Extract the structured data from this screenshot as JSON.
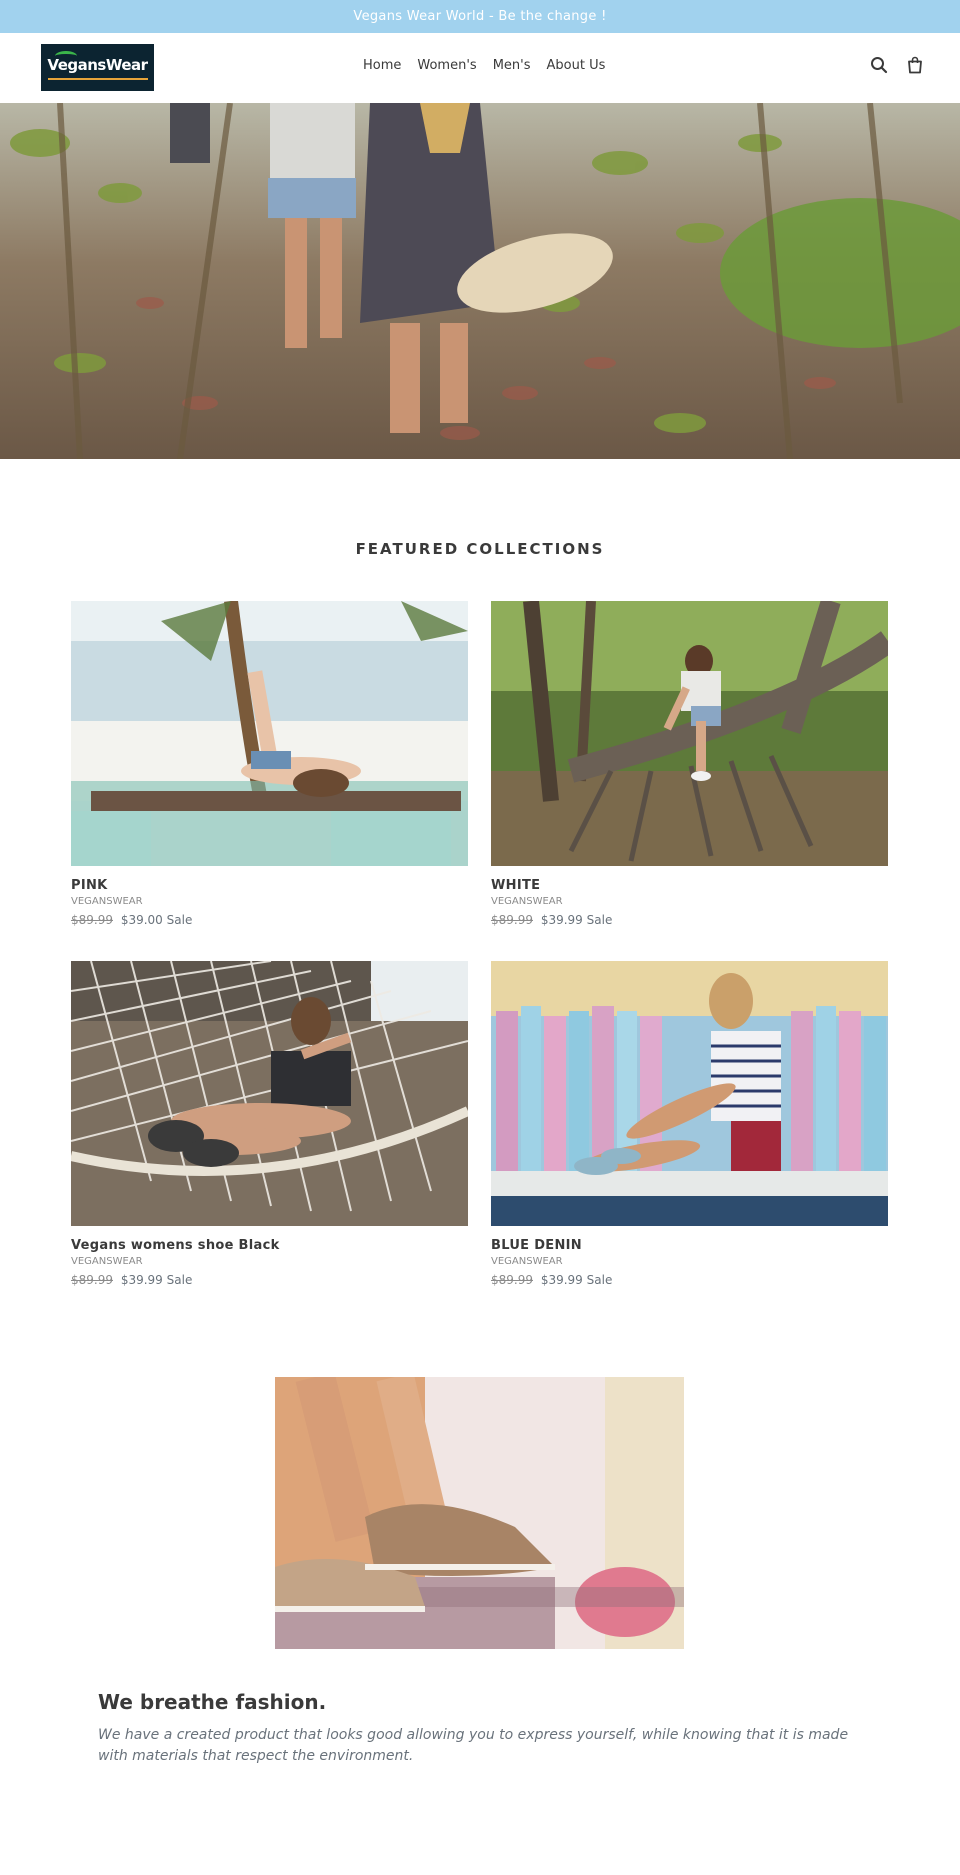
{
  "announcement": {
    "text": "Vegans Wear World - Be the change !"
  },
  "header": {
    "logo_text": "VegansWear",
    "nav": [
      {
        "label": "Home"
      },
      {
        "label": "Women's"
      },
      {
        "label": "Men's"
      },
      {
        "label": "About Us"
      }
    ],
    "icons": [
      "search-icon",
      "cart-icon"
    ]
  },
  "colors": {
    "announcement_bg": "#a1d2ee",
    "logo_bg": "#0c2431",
    "text": "#3a3a3a",
    "price": "#69727b"
  },
  "featured": {
    "title": "FEATURED COLLECTIONS",
    "products": [
      {
        "title": "PINK",
        "vendor": "VEGANSWEAR",
        "old_price": "$89.99",
        "price": "$39.00",
        "sale": "Sale"
      },
      {
        "title": "WHITE",
        "vendor": "VEGANSWEAR",
        "old_price": "$89.99",
        "price": "$39.99",
        "sale": "Sale"
      },
      {
        "title": "Vegans womens shoe Black",
        "vendor": "VEGANSWEAR",
        "old_price": "$89.99",
        "price": "$39.99",
        "sale": "Sale"
      },
      {
        "title": "BLUE DENIN",
        "vendor": "VEGANSWEAR",
        "old_price": "$89.99",
        "price": "$39.99",
        "sale": "Sale"
      }
    ]
  },
  "story": {
    "title": "We breathe fashion.",
    "text": "We have a created product that looks good allowing you to express yourself, while knowing that it is made with materials that respect the environment."
  }
}
